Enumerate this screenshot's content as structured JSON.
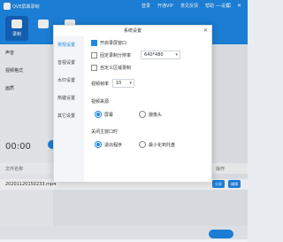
{
  "app": {
    "title": "QVE屏幕录制",
    "menu": [
      "登录",
      "开通VIP",
      "意见反馈",
      "帮助",
      "设置"
    ],
    "window_buttons": [
      "—",
      "☐",
      "✕"
    ]
  },
  "toolbar": {
    "modes": [
      {
        "label": "录制",
        "icon": "video-camera-icon",
        "active": true
      },
      {
        "label": "",
        "icon": "screen-icon",
        "active": false
      },
      {
        "label": "",
        "icon": "region-icon",
        "active": false
      }
    ]
  },
  "left_panel": {
    "labels": [
      "声音",
      "视频格式",
      "画质"
    ],
    "timer": "00:00",
    "table_header": [
      "文件名称",
      "操作"
    ],
    "file_name": "20201120150233.mp4",
    "row_actions": [
      "分享",
      "编辑"
    ]
  },
  "dialog": {
    "title": "系统设置",
    "nav": [
      "常规设置",
      "音视设置",
      "水印设置",
      "热键设置",
      "其它设置"
    ],
    "active_nav": 0,
    "options": {
      "open_preview": {
        "label": "开启录屏窗口",
        "checked": true
      },
      "fixed_resolution": {
        "label": "固定录制分辨率",
        "checked": false
      },
      "resolution_value": "640*480",
      "custom_region": {
        "label": "自定义区域录制",
        "checked": false
      },
      "fps_label": "视频帧率",
      "fps_value": "10",
      "video_source_label": "视频来源",
      "video_source_options": [
        "屏幕",
        "摄像头"
      ],
      "video_source_selected": 0,
      "close_main_label": "关闭主窗口时",
      "close_main_options": [
        "退出程序",
        "最小化到托盘"
      ],
      "close_main_selected": 0
    }
  }
}
